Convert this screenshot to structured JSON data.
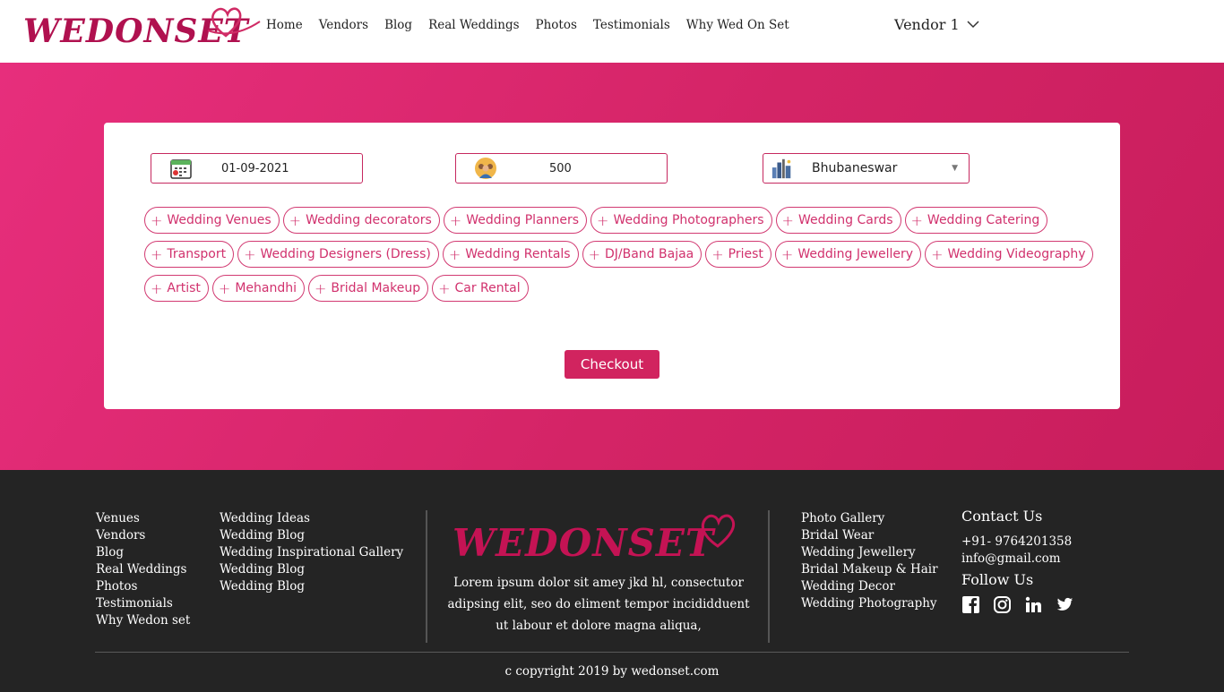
{
  "brand": {
    "name": "WEDONSET",
    "accent": "#d1245f",
    "hero_bg": "#e02a73",
    "footer_bg": "#242424"
  },
  "nav": {
    "items": [
      "Home",
      "Vendors",
      "Blog",
      "Real Weddings",
      "Photos",
      "Testimonials",
      "Why Wed On Set"
    ],
    "user_menu": "Vendor 1"
  },
  "search": {
    "date": "01-09-2021",
    "guests": "500",
    "city": "Bhubaneswar"
  },
  "categories": {
    "row1": [
      "Wedding Venues",
      "Wedding decorators",
      "Wedding Planners",
      "Wedding Photographers",
      "Wedding Cards",
      "Wedding Catering"
    ],
    "row2": [
      "Transport",
      "Wedding Designers (Dress)",
      "Wedding Rentals",
      "DJ/Band Bajaa",
      "Priest",
      "Wedding Jewellery",
      "Wedding Videography"
    ],
    "row3": [
      "Artist",
      "Mehandhi",
      "Bridal Makeup",
      "Car Rental"
    ]
  },
  "checkout_label": "Checkout",
  "footer": {
    "col1": [
      "Venues",
      "Vendors",
      "Blog",
      "Real Weddings",
      "Photos",
      "Testimonials",
      "Why Wedon set"
    ],
    "col2": [
      "Wedding Ideas",
      "Wedding Blog",
      "Wedding Inspirational Gallery",
      "Wedding Blog",
      "Wedding Blog"
    ],
    "col3": [
      "Photo Gallery",
      "Bridal Wear",
      "Wedding Jewellery",
      "Bridal Makeup & Hair",
      "Wedding Decor",
      "Wedding Photography"
    ],
    "description": "Lorem ipsum dolor sit amey jkd hl, consectutor adipsing elit, seo do eliment tempor incididduent ut labour et dolore magna aliqua,",
    "contact_title": "Contact Us",
    "phone": "+91- 9764201358",
    "email": "info@gmail.com",
    "follow_title": "Follow Us",
    "social_icons": [
      "facebook-icon",
      "instagram-icon",
      "linkedin-icon",
      "twitter-icon"
    ],
    "copyright": "c copyright 2019 by wedonset.com"
  }
}
